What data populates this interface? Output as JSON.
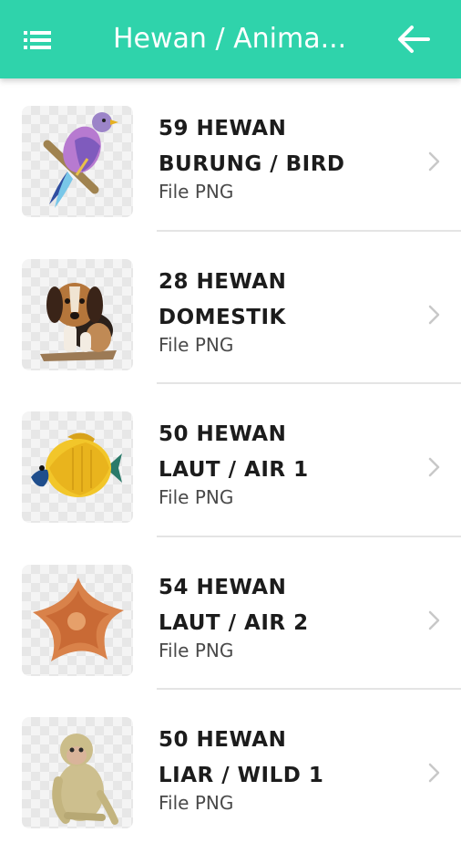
{
  "appbar": {
    "title": "Hewan / Anima...",
    "background": "#2fd3ab",
    "menu_icon": "menu-list-icon",
    "back_icon": "arrow-left-icon"
  },
  "items": [
    {
      "line1": "59 HEWAN",
      "line2": "BURUNG / BIRD",
      "subtitle": "File PNG",
      "thumb": "bird"
    },
    {
      "line1": "28 HEWAN",
      "line2": "DOMESTIK",
      "subtitle": "File PNG",
      "thumb": "dog"
    },
    {
      "line1": "50 HEWAN",
      "line2": "LAUT / AIR 1",
      "subtitle": "File PNG",
      "thumb": "fish"
    },
    {
      "line1": "54 HEWAN",
      "line2": "LAUT / AIR 2",
      "subtitle": "File PNG",
      "thumb": "starfish"
    },
    {
      "line1": "50 HEWAN",
      "line2": "LIAR / WILD 1",
      "subtitle": "File PNG",
      "thumb": "monkey"
    }
  ]
}
